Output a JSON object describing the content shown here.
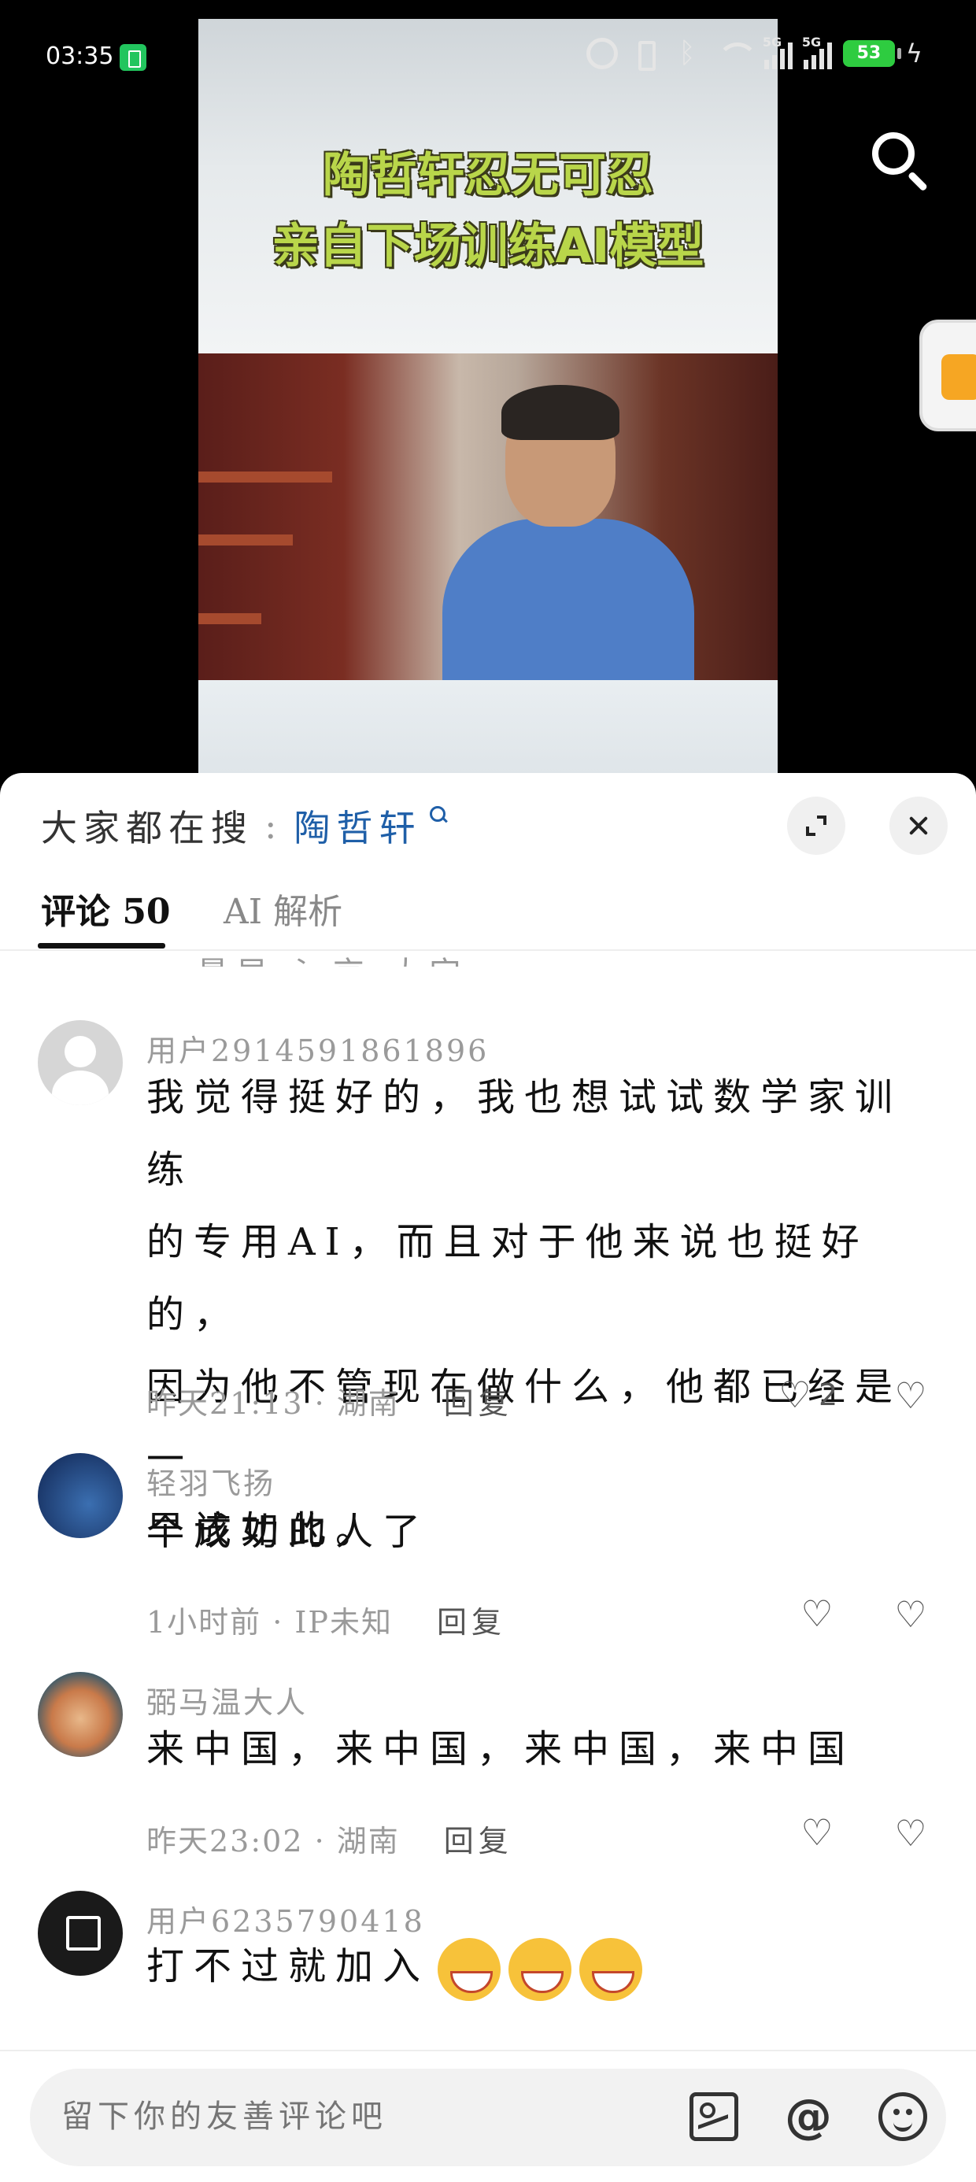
{
  "status_bar": {
    "time": "03:35",
    "battery": "53",
    "network": [
      "5G",
      "5G"
    ]
  },
  "video": {
    "title_line1": "陶哲轩忍无可忍",
    "title_line2": "亲自下场训练AI模型",
    "title_color": "#b9d64a"
  },
  "sheet": {
    "hot_search_label": "大家都在搜",
    "hot_search_colon": ":",
    "hot_search_keyword": "陶哲轩",
    "keyword_color": "#1f5fa8"
  },
  "tabs": [
    {
      "label": "评论 50",
      "active": true
    },
    {
      "label": "AI 解析",
      "active": false
    }
  ],
  "cut_off_text": "最早 氵京 大定",
  "comments": [
    {
      "username": "用户2914591861896",
      "lines": [
        "我觉得挺好的，我也想试试数学家训练",
        "的专用AI，而且对于他来说也挺好的，",
        "因为他不管现在做什么，他都已经是一",
        "个成功的人了"
      ],
      "meta": "昨天21:13 · 湖南",
      "reply": "回复",
      "likes": "2"
    },
    {
      "username": "轻羽飞扬",
      "lines": [
        "早该如此。"
      ],
      "meta": "1小时前 · IP未知",
      "reply": "回复",
      "likes": ""
    },
    {
      "username": "弼马温大人",
      "lines": [
        "来中国，来中国，来中国，来中国"
      ],
      "meta": "昨天23:02 · 湖南",
      "reply": "回复",
      "likes": ""
    },
    {
      "username": "用户6235790418",
      "lines": [
        "打不过就加入"
      ],
      "meta": "",
      "reply": "",
      "likes": ""
    }
  ],
  "input": {
    "placeholder": "留下你的友善评论吧"
  },
  "icons": {
    "search": "search-icon",
    "expand": "expand-icon",
    "close": "close-icon",
    "like": "heart-icon",
    "dislike": "dislike-icon",
    "image": "image-icon",
    "mention": "at-icon",
    "emoji": "emoji-icon"
  }
}
